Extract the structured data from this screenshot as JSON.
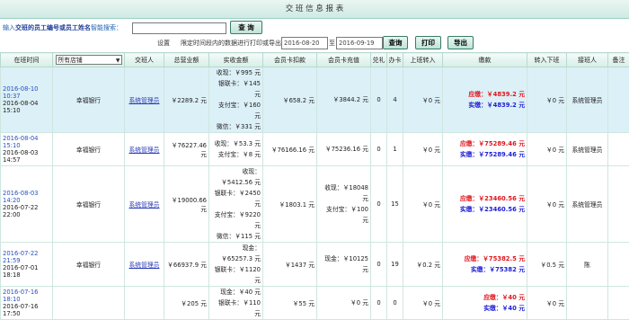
{
  "page": {
    "title": "交 班 信 息 报 表"
  },
  "search": {
    "label_prefix": "输入",
    "label_bold": "交班的员工编号或员工姓名",
    "label_suffix": "智能搜索：",
    "value": "",
    "button": "查 询"
  },
  "toolbar": {
    "settings": "设置",
    "range_text": "限定时间段内的数据进行打印或导出",
    "date_from": "2016-08-20",
    "to": "至",
    "date_to": "2016-09-19",
    "query_button": "查询",
    "print_button": "打印",
    "export_button": "导出"
  },
  "columns": {
    "shift_time": "在班时间",
    "shop": "所有店铺",
    "handover_person": "交班人",
    "total_revenue": "总营业额",
    "actual_collection": "实收金额",
    "member_card_deduct": "会员卡扣款",
    "member_card_recharge": "会员卡充值",
    "gift": "兑礼",
    "card": "办卡",
    "shift_in": "上班转入",
    "payable": "缴款",
    "shift_out": "转入下班",
    "receiver": "接班人",
    "remark": "备注"
  },
  "rows": [
    {
      "time_start": "2016-08-10 10:37",
      "time_end": "2016-08-04 15:10",
      "shop": "幸福银行",
      "handover": "系统管理员",
      "total": "￥2289.2 元",
      "collection": [
        "收现：￥995 元",
        "银联卡：￥145 元",
        "支付宝：￥160 元",
        "微信：￥331 元"
      ],
      "deduct": "￥658.2 元",
      "recharge_lines": [
        "￥3844.2 元"
      ],
      "gift": "0",
      "card": "4",
      "shift_in": "￥0 元",
      "due": "应缴：￥4839.2 元",
      "paid": "实缴：￥4839.2 元",
      "shift_out": "￥0 元",
      "receiver": "系统管理员",
      "remark": ""
    },
    {
      "time_start": "2016-08-04 15:10",
      "time_end": "2016-08-03 14:57",
      "shop": "幸福银行",
      "handover": "系统管理员",
      "total": "￥76227.46 元",
      "collection": [
        "收现：￥53.3 元",
        "支付宝：￥8 元"
      ],
      "deduct": "￥76166.16 元",
      "recharge_lines": [
        "￥75236.16 元"
      ],
      "gift": "0",
      "card": "1",
      "shift_in": "￥0 元",
      "due": "应缴：￥75289.46 元",
      "paid": "实缴：￥75289.46 元",
      "shift_out": "￥0 元",
      "receiver": "系统管理员",
      "remark": ""
    },
    {
      "time_start": "2016-08-03 14:20",
      "time_end": "2016-07-22 22:00",
      "shop": "幸福银行",
      "handover": "系统管理员",
      "total": "￥19000.66 元",
      "collection": [
        "收现：￥5412.56 元",
        "银联卡：￥2450 元",
        "支付宝：￥9220 元",
        "微信：￥115 元"
      ],
      "deduct": "￥1803.1 元",
      "recharge_lines": [
        "收现：￥18048 元",
        "支付宝：￥100 元"
      ],
      "gift": "0",
      "card": "15",
      "shift_in": "￥0 元",
      "due": "应缴：￥23460.56 元",
      "paid": "实缴：￥23460.56 元",
      "shift_out": "￥0 元",
      "receiver": "系统管理员",
      "remark": ""
    },
    {
      "time_start": "2016-07-22 21:59",
      "time_end": "2016-07-01 18:18",
      "shop": "幸福银行",
      "handover": "系统管理员",
      "total": "￥66937.9 元",
      "collection": [
        "现金：￥65257.3 元",
        "银联卡：￥1120 元"
      ],
      "deduct": "￥1437 元",
      "recharge_lines": [
        "现金：￥10125 元"
      ],
      "gift": "0",
      "card": "19",
      "shift_in": "￥0.2 元",
      "due": "应缴：￥75382.5 元",
      "paid": "实缴：￥75382 元",
      "shift_out": "￥0.5 元",
      "receiver": "陈",
      "remark": ""
    },
    {
      "time_start": "2016-07-16 18:10",
      "time_end": "2016-07-16 17:50",
      "shop": "",
      "handover": "",
      "total": "￥205 元",
      "collection": [
        "现金：￥40 元",
        "银联卡：￥110 元"
      ],
      "deduct": "￥55 元",
      "recharge_lines": [
        "￥0 元"
      ],
      "gift": "0",
      "card": "0",
      "shift_in": "￥0 元",
      "due": "应缴：￥40 元",
      "paid": "实缴：￥40 元",
      "shift_out": "￥0 元",
      "receiver": "",
      "remark": ""
    }
  ]
}
